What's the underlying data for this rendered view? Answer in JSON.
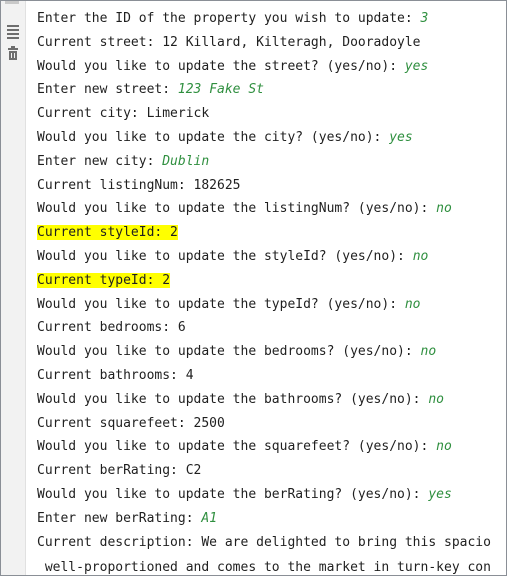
{
  "gutter": {
    "icons": [
      "scroll-to-end-icon",
      "trash-icon"
    ]
  },
  "console": {
    "lines": [
      {
        "text": "Enter the ID of the property you wish to update: ",
        "input": "3"
      },
      {
        "text": "Current street: 12 Killard, Kilteragh, Dooradoyle",
        "input": ""
      },
      {
        "text": "Would you like to update the street? (yes/no): ",
        "input": "yes"
      },
      {
        "text": "Enter new street: ",
        "input": "123 Fake St"
      },
      {
        "text": "Current city: Limerick",
        "input": ""
      },
      {
        "text": "Would you like to update the city? (yes/no): ",
        "input": "yes"
      },
      {
        "text": "Enter new city: ",
        "input": "Dublin"
      },
      {
        "text": "Current listingNum: 182625",
        "input": ""
      },
      {
        "text": "Would you like to update the listingNum? (yes/no): ",
        "input": "no"
      },
      {
        "text": "Current styleId: 2",
        "input": "",
        "highlight": true
      },
      {
        "text": "Would you like to update the styleId? (yes/no): ",
        "input": "no"
      },
      {
        "text": "Current typeId: 2",
        "input": "",
        "highlight": true
      },
      {
        "text": "Would you like to update the typeId? (yes/no): ",
        "input": "no"
      },
      {
        "text": "Current bedrooms: 6",
        "input": ""
      },
      {
        "text": "Would you like to update the bedrooms? (yes/no): ",
        "input": "no"
      },
      {
        "text": "Current bathrooms: 4",
        "input": ""
      },
      {
        "text": "Would you like to update the bathrooms? (yes/no): ",
        "input": "no"
      },
      {
        "text": "Current squarefeet: 2500",
        "input": ""
      },
      {
        "text": "Would you like to update the squarefeet? (yes/no): ",
        "input": "no"
      },
      {
        "text": "Current berRating: C2",
        "input": ""
      },
      {
        "text": "Would you like to update the berRating? (yes/no): ",
        "input": "yes"
      },
      {
        "text": "Enter new berRating: ",
        "input": "A1"
      },
      {
        "text": "Current description: We are delighted to bring this spacio",
        "input": ""
      },
      {
        "text": " well-proportioned and comes to the market in turn-key con",
        "input": ""
      }
    ]
  },
  "colors": {
    "input_text": "#2f8f3f",
    "highlight": "#ffff00",
    "gutter_bg": "#f2f2f2"
  }
}
